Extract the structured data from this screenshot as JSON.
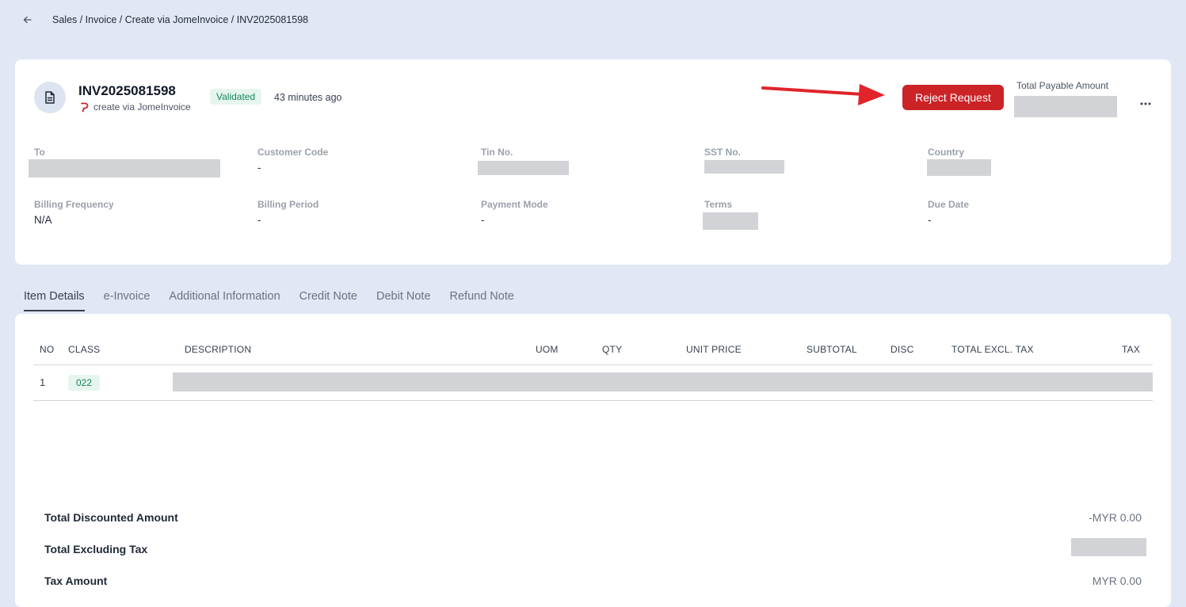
{
  "breadcrumb": "Sales / Invoice / Create via JomeInvoice / INV2025081598",
  "header": {
    "invoice_number": "INV2025081598",
    "source": "create via JomeInvoice",
    "status": "Validated",
    "time_ago": "43 minutes ago",
    "reject_label": "Reject Request",
    "total_label": "Total Payable Amount"
  },
  "fields": {
    "to_label": "To",
    "customer_code_label": "Customer Code",
    "customer_code": "-",
    "tin_label": "Tin No.",
    "sst_label": "SST No.",
    "country_label": "Country",
    "billing_frequency_label": "Billing Frequency",
    "billing_frequency": "N/A",
    "billing_period_label": "Billing Period",
    "billing_period": "-",
    "payment_mode_label": "Payment Mode",
    "payment_mode": "-",
    "terms_label": "Terms",
    "due_date_label": "Due Date",
    "due_date": "-"
  },
  "tabs": [
    "Item Details",
    "e-Invoice",
    "Additional Information",
    "Credit Note",
    "Debit Note",
    "Refund Note"
  ],
  "table": {
    "columns": [
      "NO",
      "CLASS",
      "DESCRIPTION",
      "UOM",
      "QTY",
      "UNIT PRICE",
      "SUBTOTAL",
      "DISC",
      "TOTAL EXCL. TAX",
      "TAX"
    ],
    "rows": [
      {
        "no": "1",
        "class": "022"
      }
    ]
  },
  "summary": {
    "discount_label": "Total Discounted Amount",
    "discount_value": "-MYR 0.00",
    "excl_tax_label": "Total Excluding Tax",
    "tax_label": "Tax Amount",
    "tax_value": "MYR 0.00"
  },
  "colors": {
    "accent_red": "#cc2327",
    "badge_green": "#16875a",
    "background": "#e1e7f5"
  }
}
